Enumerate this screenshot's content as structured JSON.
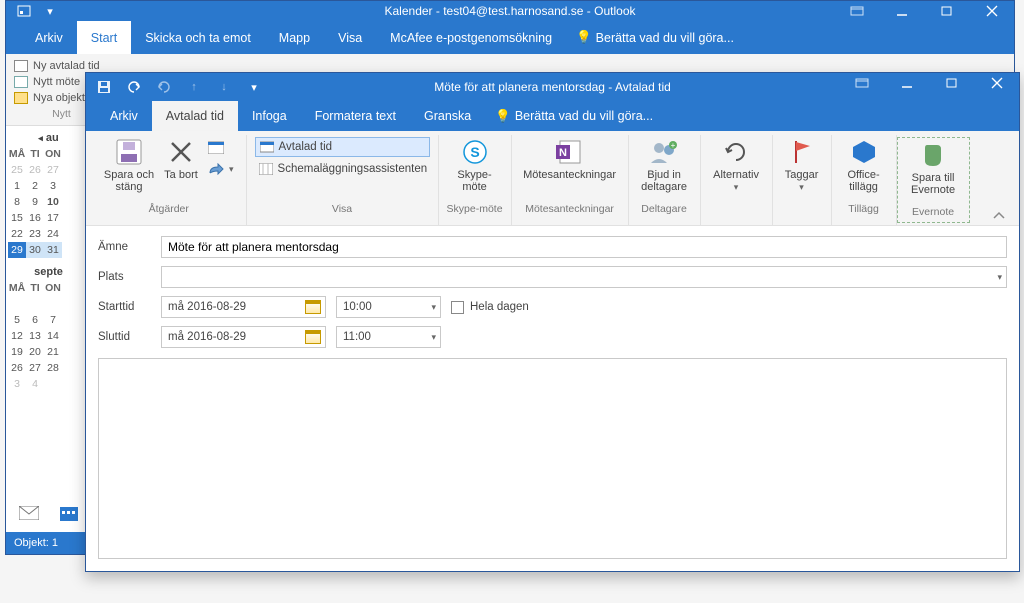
{
  "outlook": {
    "title": "Kalender - test04@test.harnosand.se - Outlook",
    "menu": {
      "arkiv": "Arkiv",
      "start": "Start",
      "skicka": "Skicka och ta emot",
      "mapp": "Mapp",
      "visa": "Visa",
      "mcafee": "McAfee e-postgenomsökning",
      "tell": "Berätta vad du vill göra..."
    },
    "toolbar": {
      "ny_avtalad": "Ny avtalad tid",
      "nytt_mote": "Nytt möte",
      "nya_objekt": "Nya objekt",
      "grouplabel_nytt": "Nytt"
    },
    "calendar": {
      "month1_label": "au",
      "month2_label": "septe",
      "dow": [
        "MÅ",
        "TI",
        "ON"
      ],
      "m1_rows": [
        [
          "25",
          "26",
          "27"
        ],
        [
          "1",
          "2",
          "3"
        ],
        [
          "8",
          "9",
          "10"
        ],
        [
          "15",
          "16",
          "17"
        ],
        [
          "22",
          "23",
          "24"
        ],
        [
          "29",
          "30",
          "31"
        ]
      ],
      "m2_rows": [
        [
          "",
          "",
          ""
        ],
        [
          "5",
          "6",
          "7"
        ],
        [
          "12",
          "13",
          "14"
        ],
        [
          "19",
          "20",
          "21"
        ],
        [
          "26",
          "27",
          "28"
        ],
        [
          "3",
          "4",
          ""
        ]
      ]
    },
    "status": {
      "objekt": "Objekt: 1"
    }
  },
  "appt": {
    "title": "Möte för att planera mentorsdag - Avtalad tid",
    "menu": {
      "arkiv": "Arkiv",
      "avtalad": "Avtalad tid",
      "infoga": "Infoga",
      "formatera": "Formatera text",
      "granska": "Granska",
      "tell": "Berätta vad du vill göra..."
    },
    "ribbon": {
      "spara_stang": "Spara och stäng",
      "ta_bort": "Ta bort",
      "atgarder": "Åtgärder",
      "avtalad_tid_btn": "Avtalad tid",
      "schema": "Schemaläggningsassistenten",
      "visa": "Visa",
      "skype": "Skype-möte",
      "skype_grp": "Skype-möte",
      "motesant": "Mötesanteckningar",
      "motesant_grp": "Mötesanteckningar",
      "bjud": "Bjud in deltagare",
      "deltagare": "Deltagare",
      "alternativ": "Alternativ",
      "taggar": "Taggar",
      "office_tillagg": "Office-tillägg",
      "tillagg": "Tillägg",
      "spara_evernote": "Spara till Evernote",
      "evernote": "Evernote"
    },
    "fields": {
      "amne_label": "Ämne",
      "amne_value": "Möte för att planera mentorsdag",
      "plats_label": "Plats",
      "plats_value": "",
      "starttid_label": "Starttid",
      "start_date": "må 2016-08-29",
      "start_time": "10:00",
      "sluttid_label": "Sluttid",
      "end_date": "må 2016-08-29",
      "end_time": "11:00",
      "heldag": "Hela dagen"
    }
  }
}
